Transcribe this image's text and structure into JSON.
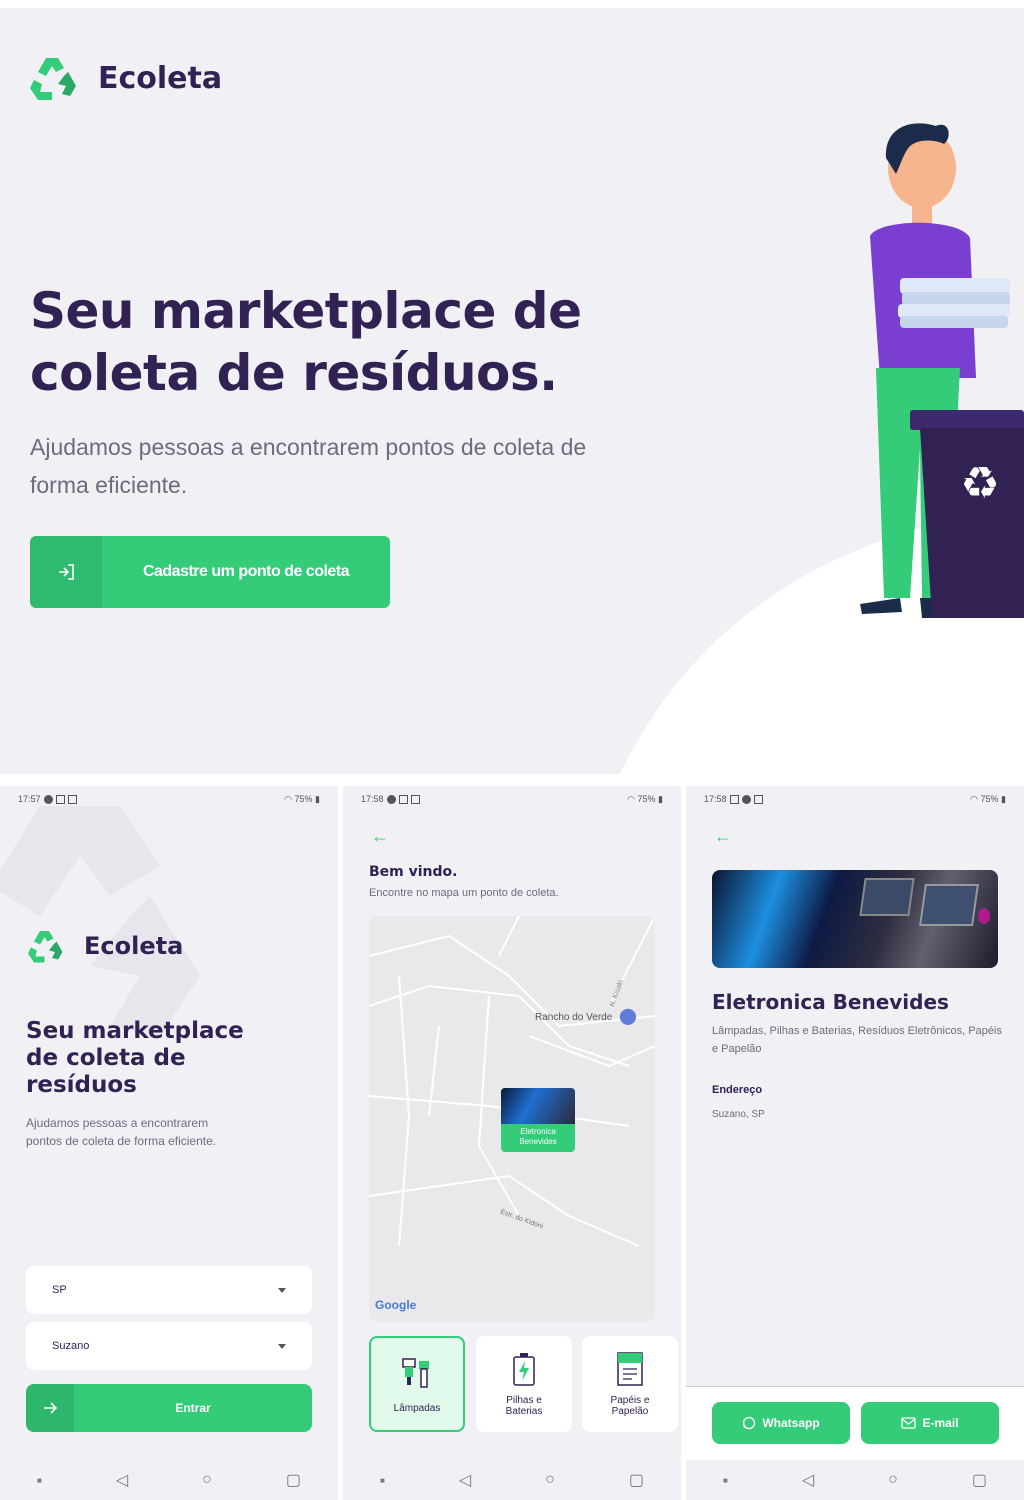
{
  "colors": {
    "primary": "#34cb79",
    "title": "#322153",
    "text": "#6c6c80",
    "background": "#f0f0f5"
  },
  "web": {
    "brand": "Ecoleta",
    "hero_title": "Seu marketplace de coleta de resíduos.",
    "hero_subtitle": "Ajudamos pessoas a encontrarem pontos de coleta de forma eficiente.",
    "cta_label": "Cadastre um ponto de coleta",
    "cta_icon": "log-in-icon"
  },
  "phone_home": {
    "status_time": "17:57",
    "status_right": "75%",
    "brand": "Ecoleta",
    "title": "Seu marketplace de coleta de resíduos",
    "subtitle": "Ajudamos pessoas a encontrarem pontos de coleta de forma eficiente.",
    "uf_value": "SP",
    "city_value": "Suzano",
    "enter_label": "Entrar"
  },
  "phone_map": {
    "status_time": "17:58",
    "status_right": "75%",
    "greeting": "Bem vindo.",
    "description": "Encontre no mapa um ponto de coleta.",
    "map_place_label": "Rancho do Verde",
    "map_road_label": "Estr. do Kidoni",
    "map_street_label": "R. Kisaki",
    "map_provider": "Google",
    "marker_label": "Eletronica Benevides",
    "items": [
      {
        "label": "Lâmpadas",
        "icon": "lamp-icon",
        "selected": true
      },
      {
        "label": "Pilhas e Baterias",
        "icon": "battery-icon",
        "selected": false
      },
      {
        "label": "Papéis e Papelão",
        "icon": "paper-icon",
        "selected": false
      }
    ]
  },
  "phone_detail": {
    "status_time": "17:58",
    "status_right": "75%",
    "point_name": "Eletronica Benevides",
    "point_items": "Lâmpadas, Pilhas e Baterias, Resíduos Eletrônicos, Papéis e Papelão",
    "address_label": "Endereço",
    "address_value": "Suzano, SP",
    "whatsapp_label": "Whatsapp",
    "email_label": "E-mail"
  }
}
